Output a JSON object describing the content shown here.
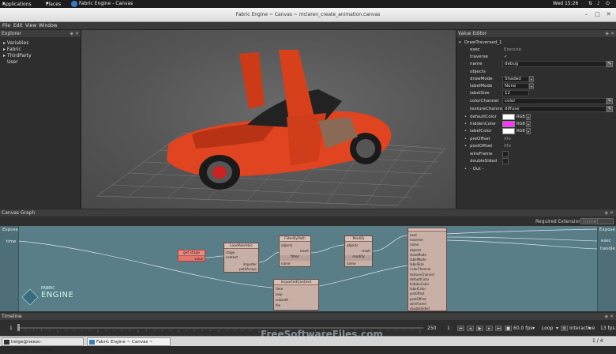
{
  "topbar": {
    "applications": "Applications",
    "places": "Places",
    "app_name": "Fabric Engine - Canvas",
    "clock": "Wed 15:26"
  },
  "window": {
    "title": "Fabric Engine ~ Canvas ~ mclaren_create_animation.canvas"
  },
  "menu": {
    "file": "File",
    "edit": "Edit",
    "view": "View",
    "window": "Window"
  },
  "explorer": {
    "title": "Explorer",
    "items": [
      "Variables",
      "Fabric",
      "ThirdParty",
      "User"
    ]
  },
  "value_editor": {
    "title": "Value Editor",
    "node": "DrawTraversed_1",
    "rows": {
      "exec_label": "exec",
      "exec_value": "Execute",
      "traverse_label": "traverse",
      "traverse_value": "✓",
      "name_label": "name",
      "name_value": "debug",
      "objects_label": "objects",
      "drawmode_label": "drawMode",
      "drawmode_value": "Shaded",
      "labelmode_label": "labelMode",
      "labelmode_value": "None",
      "labelsize_label": "labelSize",
      "labelsize_value": "12",
      "colorchannel_label": "colorChannel",
      "colorchannel_value": "color",
      "texturechannel_label": "textureChannel",
      "texturechannel_value": "diffuse",
      "defaultcolor_label": "defaultColor",
      "defaultcolor_mode": "RGB",
      "hiddencolor_label": "hiddenColor",
      "hiddencolor_mode": "RGB",
      "labelcolor_label": "labelColor",
      "labelcolor_mode": "RGB",
      "preoffset_label": "preOffset",
      "preoffset_value": "Xfo",
      "postoffset_label": "postOffset",
      "postoffset_value": "Xfo",
      "wireframe_label": "wireFrame",
      "doublesided_label": "doubleSided",
      "out_label": "- Out -"
    },
    "colors": {
      "defaultColor": "#ffffff",
      "hiddenColor": "#ff33ff",
      "labelColor": "#ffffff"
    }
  },
  "canvas_graph": {
    "title": "Canvas Graph",
    "required_extensions_label": "Required Extensions:",
    "required_extensions_value": "(none)",
    "left_ports": [
      "Expose",
      "time"
    ],
    "right_ports": [
      "Expose",
      "exec",
      "handle"
    ],
    "logo_small": "FABRIC",
    "logo_big": "ENGINE",
    "nodes": [
      {
        "title": "get stage",
        "port": "value"
      },
      {
        "title": "LoadAlembic",
        "ports": [
          "stage",
          "context",
          "importer",
          "pathArrays"
        ]
      },
      {
        "title": "FilterByPath",
        "ports": [
          "objects",
          "result",
          "filter",
          "name"
        ]
      },
      {
        "title": "Modify",
        "ports": [
          "objects",
          "result",
          "modify",
          "name"
        ]
      },
      {
        "title": "ImportedContent",
        "ports": [
          "time",
          "loop",
          "subsetA",
          "file"
        ]
      },
      {
        "title": "DrawTraversed",
        "ports": [
          "exec",
          "traverse",
          "name",
          "objects",
          "drawMode",
          "labelMode",
          "labelSize",
          "colorChannel",
          "textureChannel",
          "defaultColor",
          "hiddenColor",
          "labelColor",
          "preOffset",
          "postOffset",
          "wireFrame",
          "doubleSided"
        ]
      }
    ]
  },
  "timeline": {
    "title": "Timeline",
    "start": "1",
    "end": "250",
    "frame": "1",
    "fps_value": "60.0 fps",
    "loop": "Loop",
    "mode": "Interactive",
    "current_fps": "13 fps"
  },
  "taskbar": {
    "terminal": "helge@nexoc-centos7:~/Desktop...",
    "canvas": "Fabric Engine ~ Canvas ~ mclaren...",
    "page": "1 / 4",
    "watermark": "FreeSoftwareFiles.com"
  }
}
